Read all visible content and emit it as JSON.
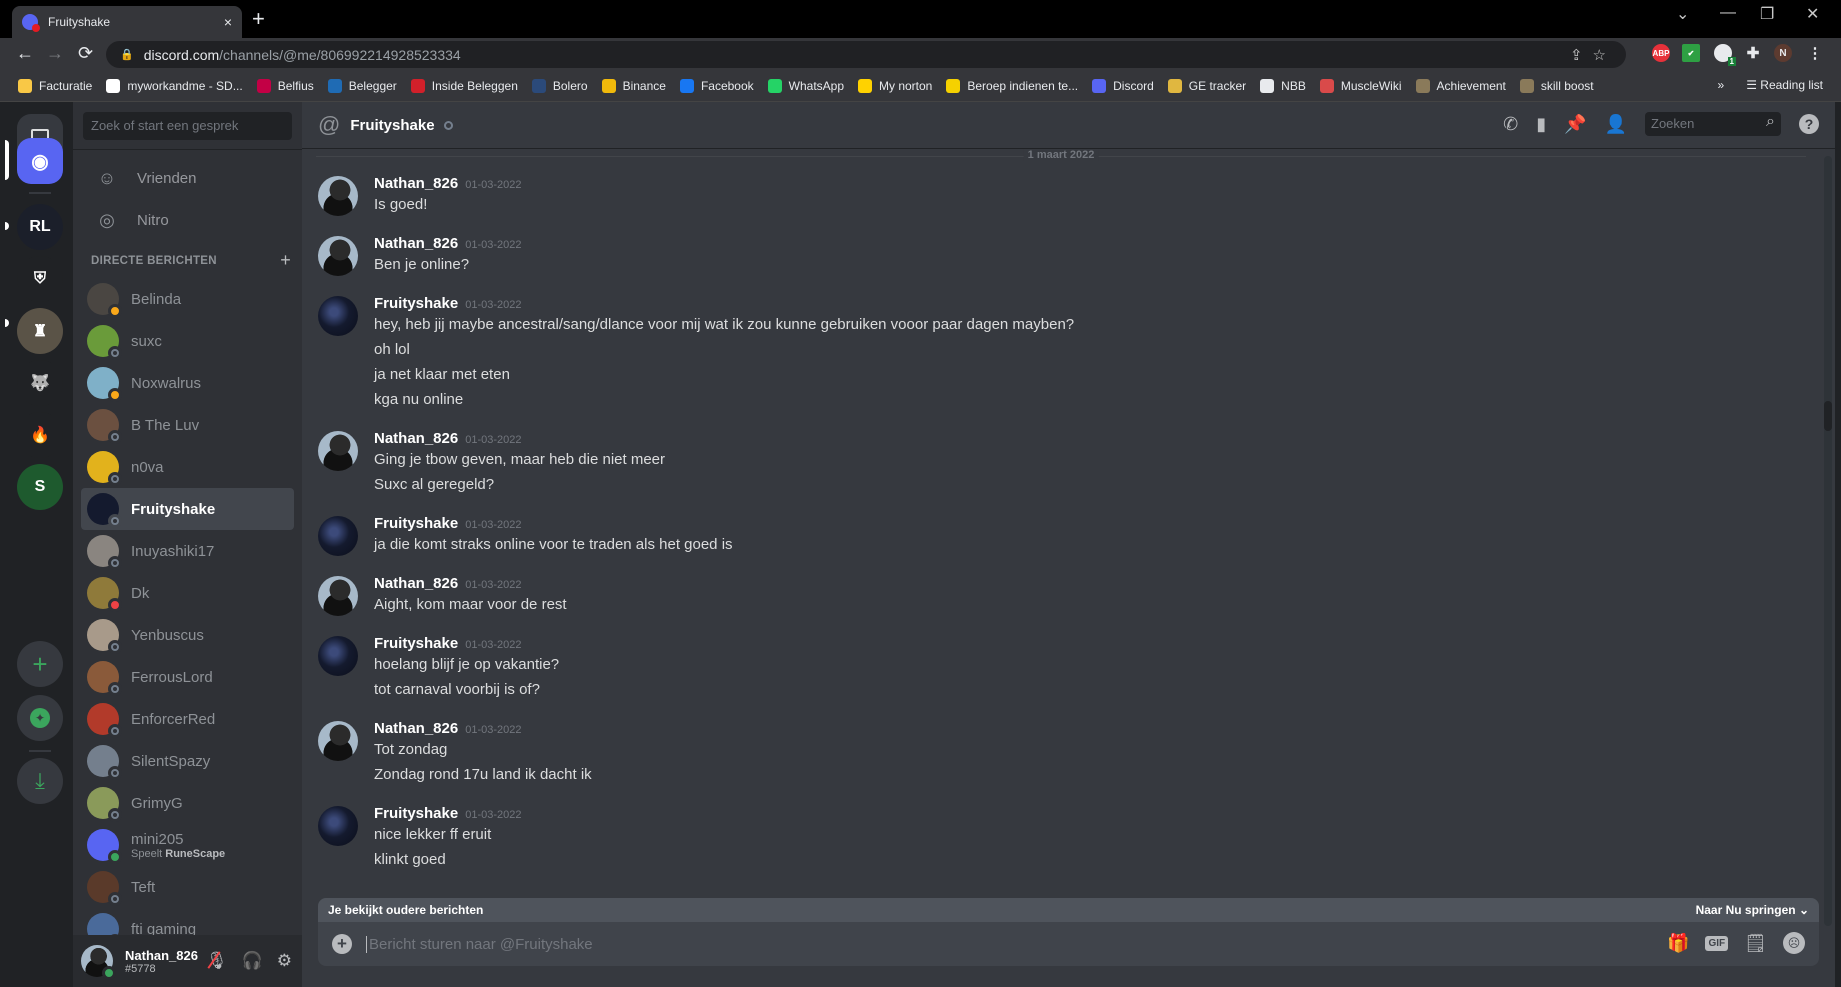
{
  "browser": {
    "tab_title": "Fruityshake",
    "tab_close": "×",
    "new_tab": "+",
    "url_host": "discord.com",
    "url_path": "/channels/@me/806992214928523334",
    "window_controls": {
      "menu": "⌄",
      "minimize": "—",
      "restore": "❐",
      "close": "✕"
    },
    "nav": {
      "back": "←",
      "forward": "→",
      "reload": "⟳"
    },
    "extensions": [
      "ABP",
      "✔",
      "1",
      "N"
    ],
    "bookmarks": [
      {
        "label": "Facturatie",
        "color": "#f9c846"
      },
      {
        "label": "myworkandme - SD...",
        "color": "#ffffff"
      },
      {
        "label": "Belfius",
        "color": "#c30045"
      },
      {
        "label": "Belegger",
        "color": "#1f6bb4"
      },
      {
        "label": "Inside Beleggen",
        "color": "#d1202a"
      },
      {
        "label": "Bolero",
        "color": "#2b4a7a"
      },
      {
        "label": "Binance",
        "color": "#f0b90b"
      },
      {
        "label": "Facebook",
        "color": "#1877f2"
      },
      {
        "label": "WhatsApp",
        "color": "#25d366"
      },
      {
        "label": "My norton",
        "color": "#ffd200"
      },
      {
        "label": "Beroep indienen te...",
        "color": "#f5d100"
      },
      {
        "label": "Discord",
        "color": "#5865f2"
      },
      {
        "label": "GE tracker",
        "color": "#e0b740"
      },
      {
        "label": "NBB",
        "color": "#e8eaed"
      },
      {
        "label": "MuscleWiki",
        "color": "#d94a4a"
      },
      {
        "label": "Achievement",
        "color": "#8a7a5a"
      },
      {
        "label": "skill boost",
        "color": "#8a7a5a"
      }
    ],
    "bookmarks_more": "»",
    "reading_list": "Reading list"
  },
  "servers": [
    {
      "name": "home",
      "label": "DM",
      "color": "#5865f2",
      "selected": true
    },
    {
      "name": "rl",
      "label": "RL",
      "color": "#1b1f2a"
    },
    {
      "name": "helmet",
      "label": "⛨",
      "color": "#202225"
    },
    {
      "name": "armour",
      "label": "♜",
      "color": "#5a5347"
    },
    {
      "name": "wolf",
      "label": "🐺",
      "color": "#202225"
    },
    {
      "name": "flame",
      "label": "🔥",
      "color": "#202225"
    },
    {
      "name": "suxc",
      "label": "S",
      "color": "#1e5a2e"
    }
  ],
  "rail_actions": {
    "add": "+",
    "explore": "✦",
    "download": "⤓"
  },
  "dm_sidebar": {
    "search_placeholder": "Zoek of start een gesprek",
    "nav": [
      {
        "label": "Vrienden",
        "icon": "☺"
      },
      {
        "label": "Nitro",
        "icon": "◎"
      }
    ],
    "section_title": "DIRECTE BERICHTEN",
    "section_add": "+",
    "dms": [
      {
        "name": "Belinda",
        "status": "idle",
        "color": "#4a4642"
      },
      {
        "name": "suxc",
        "status": "off",
        "color": "#6a9b3a"
      },
      {
        "name": "Noxwalrus",
        "status": "idle",
        "color": "#7fb0c8"
      },
      {
        "name": "B The Luv",
        "status": "off",
        "color": "#6b5040"
      },
      {
        "name": "n0va",
        "status": "off",
        "color": "#e2b21c"
      },
      {
        "name": "Fruityshake",
        "status": "off",
        "color": "#141a2e",
        "active": true
      },
      {
        "name": "Inuyashiki17",
        "status": "off",
        "color": "#8a8580"
      },
      {
        "name": "Dk",
        "status": "dnd",
        "color": "#8f7a3a"
      },
      {
        "name": "Yenbuscus",
        "status": "off",
        "color": "#a89a8a"
      },
      {
        "name": "FerrousLord",
        "status": "off",
        "color": "#8a5a3a"
      },
      {
        "name": "EnforcerRed",
        "status": "off",
        "color": "#b23a2a"
      },
      {
        "name": "SilentSpazy",
        "status": "off",
        "color": "#747f8d"
      },
      {
        "name": "GrimyG",
        "status": "off",
        "color": "#8a9a5a"
      },
      {
        "name": "mini205",
        "status": "on",
        "color": "#5865f2",
        "sub_prefix": "Speelt ",
        "sub_game": "RuneScape"
      },
      {
        "name": "Teft",
        "status": "off",
        "color": "#5a3a2a"
      },
      {
        "name": "fti gaming",
        "status": "off",
        "color": "#4a6a9a"
      }
    ]
  },
  "user_panel": {
    "name": "Nathan_826",
    "tag": "#5778",
    "status": "on"
  },
  "chat": {
    "recipient": "Fruityshake",
    "search_placeholder": "Zoeken",
    "help": "?",
    "date_divider": "1 maart 2022",
    "groups": [
      {
        "author": "Nathan_826",
        "avatar": "n",
        "timestamp": "01-03-2022",
        "lines": [
          "Is goed!"
        ]
      },
      {
        "author": "Nathan_826",
        "avatar": "n",
        "timestamp": "01-03-2022",
        "lines": [
          "Ben je online?"
        ]
      },
      {
        "author": "Fruityshake",
        "avatar": "f",
        "timestamp": "01-03-2022",
        "lines": [
          "hey, heb jij maybe ancestral/sang/dlance voor mij wat ik zou kunne gebruiken vooor paar dagen mayben?",
          "oh lol",
          "ja net klaar met eten",
          "kga nu online"
        ]
      },
      {
        "author": "Nathan_826",
        "avatar": "n",
        "timestamp": "01-03-2022",
        "lines": [
          "Ging je tbow geven, maar heb die niet meer",
          "Suxc al geregeld?"
        ]
      },
      {
        "author": "Fruityshake",
        "avatar": "f",
        "timestamp": "01-03-2022",
        "lines": [
          "ja die komt straks online voor te traden als het goed is"
        ]
      },
      {
        "author": "Nathan_826",
        "avatar": "n",
        "timestamp": "01-03-2022",
        "lines": [
          "Aight, kom maar voor de rest"
        ]
      },
      {
        "author": "Fruityshake",
        "avatar": "f",
        "timestamp": "01-03-2022",
        "lines": [
          "hoelang blijf je op vakantie?",
          "tot carnaval voorbij is of?"
        ]
      },
      {
        "author": "Nathan_826",
        "avatar": "n",
        "timestamp": "01-03-2022",
        "lines": [
          "Tot zondag",
          "Zondag rond 17u land ik dacht ik"
        ]
      },
      {
        "author": "Fruityshake",
        "avatar": "f",
        "timestamp": "01-03-2022",
        "lines": [
          "nice lekker ff eruit",
          "klinkt goed"
        ]
      }
    ],
    "older_banner": "Je bekijkt oudere berichten",
    "jump_label": "Naar Nu springen",
    "composer_placeholder": "Bericht sturen naar @Fruityshake",
    "composer_value": "",
    "gif_label": "GIF"
  }
}
